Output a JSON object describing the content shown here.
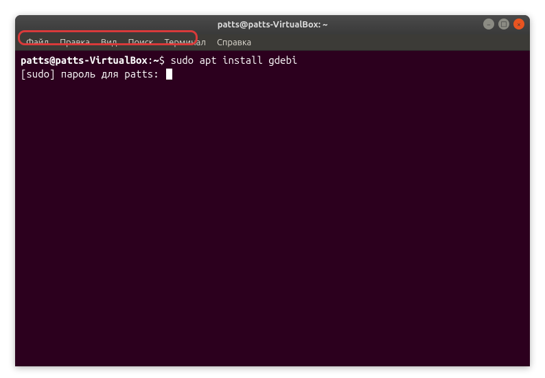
{
  "window": {
    "title": "patts@patts-VirtualBox: ~"
  },
  "menubar": {
    "items": [
      "Файл",
      "Правка",
      "Вид",
      "Поиск",
      "Терминал",
      "Справка"
    ]
  },
  "terminal": {
    "prompt_user": "patts@patts-VirtualBox",
    "prompt_sep1": ":",
    "prompt_path": "~",
    "prompt_sep2": "$ ",
    "command": "sudo apt install gdebi",
    "sudo_prompt": "[sudo] пароль для patts: "
  },
  "controls": {
    "minimize": "−",
    "maximize": "□",
    "close": "×"
  }
}
